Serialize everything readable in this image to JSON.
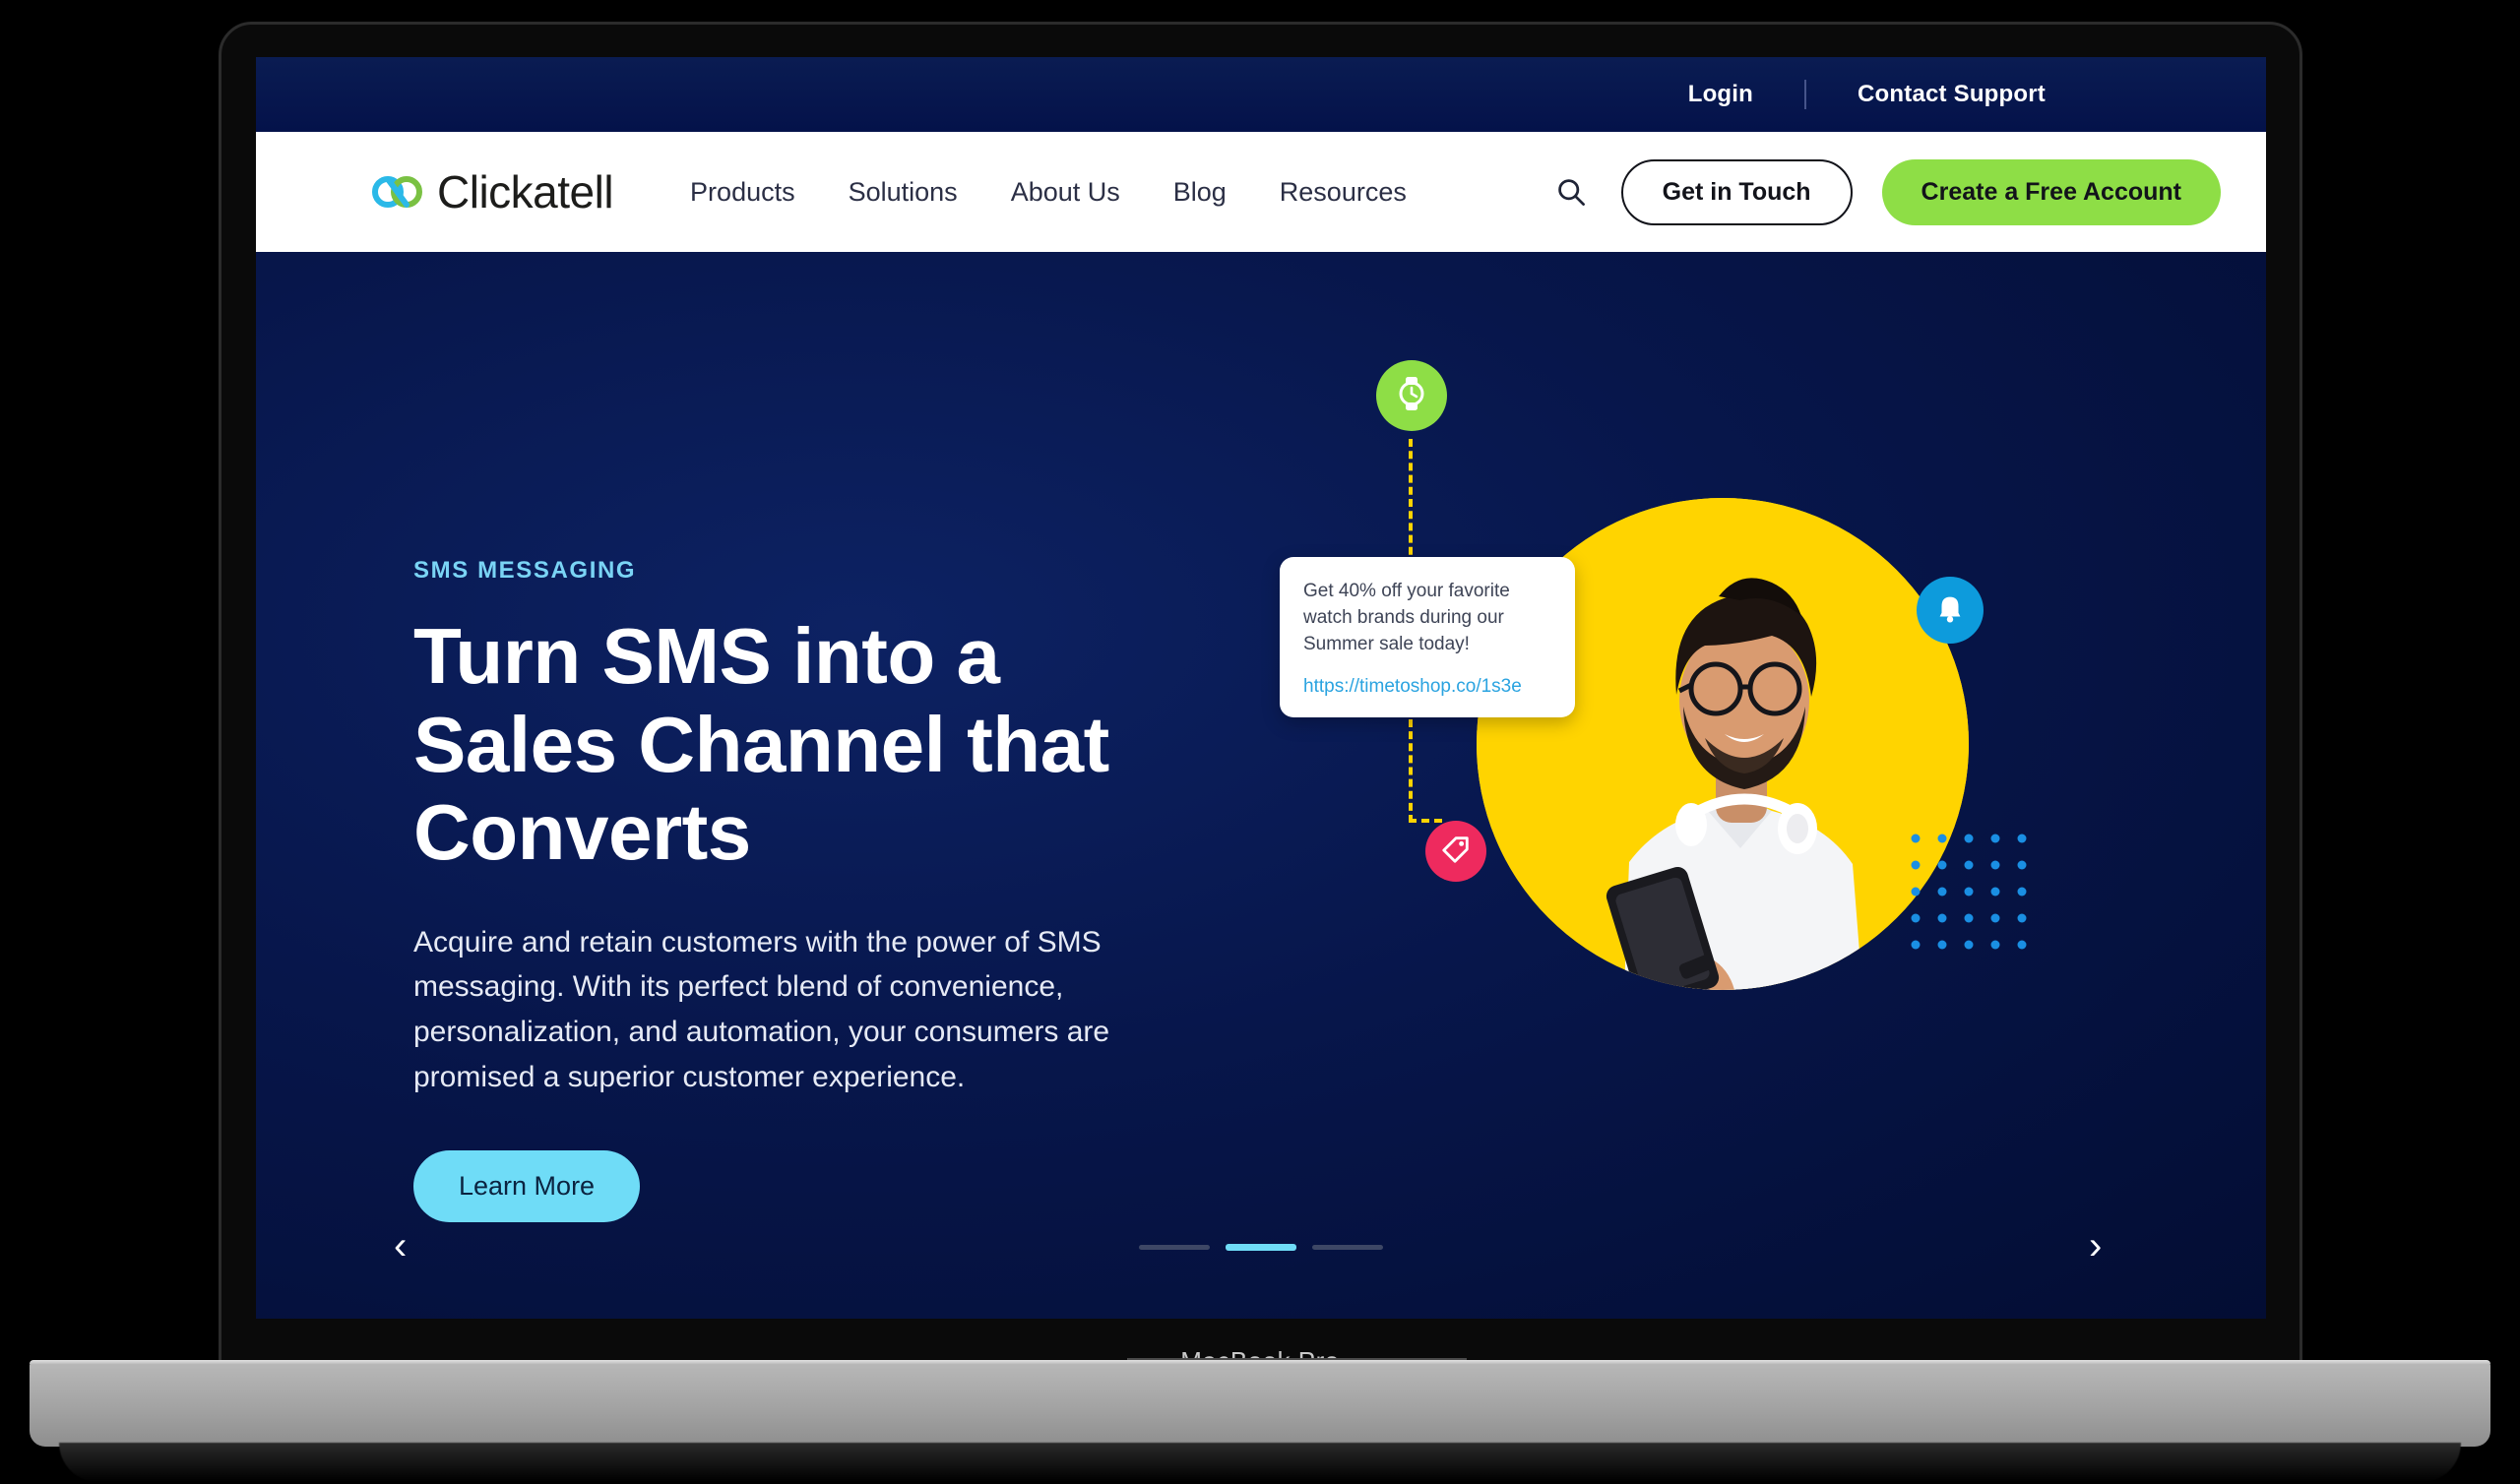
{
  "device": {
    "label": "MacBook Pro"
  },
  "topbar": {
    "login_label": "Login",
    "contact_label": "Contact Support"
  },
  "nav": {
    "logo_text": "Clickatell",
    "links": [
      {
        "label": "Products"
      },
      {
        "label": "Solutions"
      },
      {
        "label": "About Us"
      },
      {
        "label": "Blog"
      },
      {
        "label": "Resources"
      }
    ],
    "search_icon": "search-icon",
    "get_in_touch_label": "Get in Touch",
    "create_account_label": "Create a Free Account"
  },
  "hero": {
    "eyebrow": "SMS MESSAGING",
    "headline_line1": "Turn SMS into a",
    "headline_line2": "Sales Channel that",
    "headline_line3": "Converts",
    "subcopy": "Acquire and retain customers with the power of SMS messaging. With its perfect blend of convenience, personalization, and automation, your consumers are promised a superior customer experience.",
    "cta_label": "Learn More"
  },
  "art": {
    "bubble_text": "Get 40% off your favorite watch brands during our Summer sale today!",
    "bubble_link": "https://timetoshop.co/1s3e",
    "badges": [
      {
        "name": "watch-icon",
        "color": "#8ede46"
      },
      {
        "name": "bell-icon",
        "color": "#0d9bdc"
      },
      {
        "name": "tag-icon",
        "color": "#ee2a5e"
      }
    ]
  },
  "carousel": {
    "prev_icon": "‹",
    "next_icon": "›",
    "slides": [
      {
        "active": false
      },
      {
        "active": true
      },
      {
        "active": false
      }
    ]
  },
  "colors": {
    "brand_navy": "#041240",
    "accent_green": "#8ede46",
    "accent_cyan": "#6fdcf7",
    "accent_yellow": "#ffd400",
    "accent_blue": "#0d9bdc",
    "accent_pink": "#ee2a5e"
  }
}
